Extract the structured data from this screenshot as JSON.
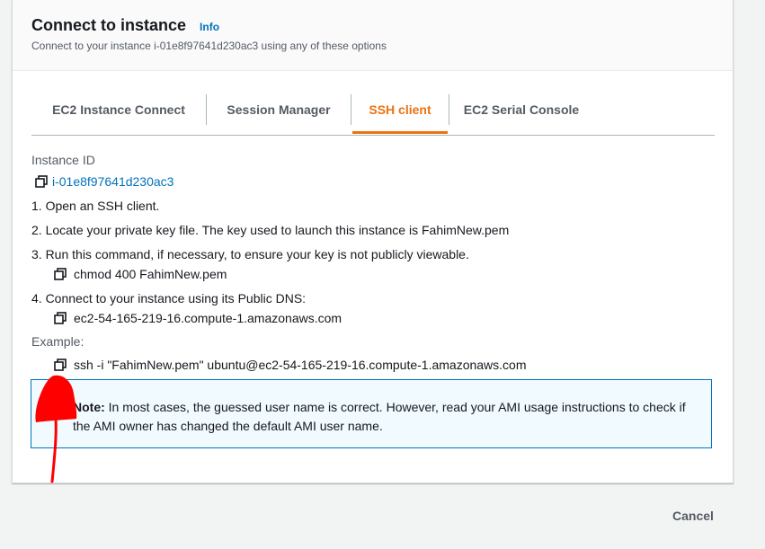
{
  "header": {
    "title": "Connect to instance",
    "info_link": "Info",
    "subtitle": "Connect to your instance i-01e8f97641d230ac3 using any of these options"
  },
  "tabs": [
    {
      "label": "EC2 Instance Connect",
      "active": false
    },
    {
      "label": "Session Manager",
      "active": false
    },
    {
      "label": "SSH client",
      "active": true
    },
    {
      "label": "EC2 Serial Console",
      "active": false
    }
  ],
  "ssh": {
    "instance_id_label": "Instance ID",
    "instance_id": "i-01e8f97641d230ac3",
    "steps": [
      "1. Open an SSH client.",
      "2. Locate your private key file. The key used to launch this instance is FahimNew.pem",
      "3. Run this command, if necessary, to ensure your key is not publicly viewable.",
      "4. Connect to your instance using its Public DNS:"
    ],
    "chmod_command": "chmod 400 FahimNew.pem",
    "public_dns": "ec2-54-165-219-16.compute-1.amazonaws.com",
    "example_label": "Example:",
    "example_command": "ssh -i \"FahimNew.pem\" ubuntu@ec2-54-165-219-16.compute-1.amazonaws.com"
  },
  "note": {
    "strong": "Note:",
    "text": " In most cases, the guessed user name is correct. However, read your AMI usage instructions to check if the AMI owner has changed the default AMI user name."
  },
  "footer": {
    "cancel_label": "Cancel"
  },
  "icons": {
    "copy": "copy-icon",
    "annotation": "red-arrow-annotation"
  },
  "colors": {
    "accent": "#ec7211",
    "link": "#0073bb",
    "note_bg": "#f1faff",
    "annotation": "#ff0000"
  }
}
